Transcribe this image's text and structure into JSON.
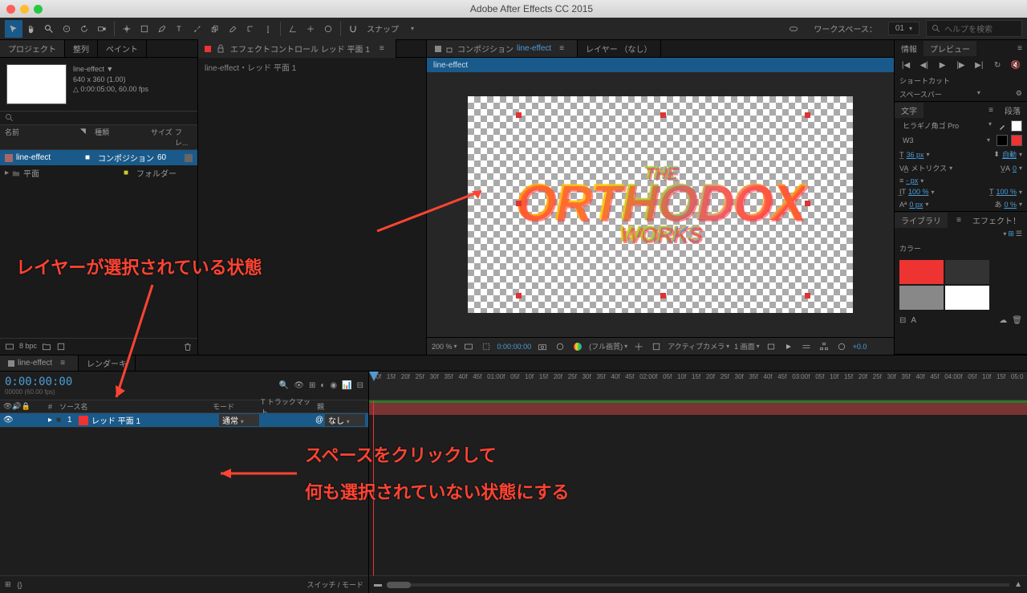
{
  "app": {
    "title": "Adobe After Effects CC 2015"
  },
  "toolbar": {
    "snap_label": "スナップ",
    "workspace_prefix": "ワークスペース：",
    "workspace": "01",
    "search_placeholder": "ヘルプを検索"
  },
  "project": {
    "tabs": {
      "project": "プロジェクト",
      "align": "整列",
      "paint": "ペイント"
    },
    "selected": {
      "name": "line-effect ▼",
      "dim": "640 x 360 (1.00)",
      "dur": "△ 0:00:05:00, 60.00 fps"
    },
    "cols": {
      "name": "名前",
      "type": "種類",
      "size": "サイズ",
      "fr": "フレ..."
    },
    "items": [
      {
        "label": "line-effect",
        "type": "コンポジション",
        "size": "60"
      },
      {
        "label": "平面",
        "type": "フォルダー",
        "size": ""
      }
    ],
    "bpc": "8 bpc"
  },
  "effect_controls": {
    "header": "エフェクトコントロール レッド 平面 1",
    "path": "line-effect・レッド 平面 1"
  },
  "composition": {
    "tab_prefix": "コンポジション",
    "comp_name": "line-effect",
    "layer_tab": "レイヤー （なし）",
    "flow": "line-effect",
    "art_text_top": "THE",
    "art_text_main": "ORTHODOX",
    "art_text_sub": "WORKS",
    "footer": {
      "zoom": "200 %",
      "time": "0:00:00:00",
      "quality": "(フル画質)",
      "camera": "アクティブカメラ",
      "views": "1 画面",
      "exposure": "+0.0"
    }
  },
  "right": {
    "info_tab": "情報",
    "preview_tab": "プレビュー",
    "shortcut": {
      "label": "ショートカット",
      "value": "スペースバー"
    },
    "char": {
      "tab": "文字",
      "para_tab": "段落",
      "font": "ヒラギノ角ゴ Pro",
      "weight": "W3",
      "size": "36 px",
      "leading": "自動",
      "kerning": "メトリクス",
      "tracking": "0",
      "stroke": "- px",
      "vscale": "100 %",
      "hscale": "100 %",
      "baseline": "0 px",
      "tsume": "0 %"
    },
    "library": {
      "tab": "ライブラリ",
      "effects_tab": "エフェクト！",
      "section": "カラー"
    }
  },
  "timeline": {
    "tab_name": "line-effect",
    "render_tab": "レンダーキ",
    "timecode": "0:00:00:00",
    "timecode_sub": "00000 (60.00 fps)",
    "cols": {
      "src": "ソース名",
      "mode": "モード",
      "trkmat": "T トラックマット",
      "parent": "親"
    },
    "layer": {
      "num": "1",
      "name": "レッド 平面 1",
      "mode": "通常",
      "parent": "なし"
    },
    "footer_label": "スイッチ / モード",
    "ruler": [
      "10f",
      "15f",
      "20f",
      "25f",
      "30f",
      "35f",
      "40f",
      "45f",
      "01:00f",
      "05f",
      "10f",
      "15f",
      "20f",
      "25f",
      "30f",
      "35f",
      "40f",
      "45f",
      "02:00f",
      "05f",
      "10f",
      "15f",
      "20f",
      "25f",
      "30f",
      "35f",
      "40f",
      "45f",
      "03:00f",
      "05f",
      "10f",
      "15f",
      "20f",
      "25f",
      "30f",
      "35f",
      "40f",
      "45f",
      "04:00f",
      "05f",
      "10f",
      "15f",
      "05:0"
    ]
  },
  "annotations": {
    "a1": "レイヤーが選択されている状態",
    "a2a": "スペースをクリックして",
    "a2b": "何も選択されていない状態にする"
  }
}
